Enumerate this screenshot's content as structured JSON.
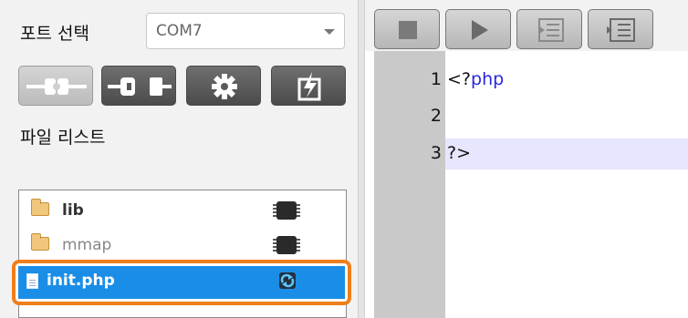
{
  "port": {
    "label": "포트 선택",
    "selected": "COM7"
  },
  "toolbar": {
    "buttons": [
      {
        "name": "connect",
        "icon": "plug-connect-icon",
        "enabled": false
      },
      {
        "name": "disconnect",
        "icon": "plug-disconnect-icon",
        "enabled": true
      },
      {
        "name": "settings",
        "icon": "gear-icon",
        "enabled": true
      },
      {
        "name": "flash",
        "icon": "flash-chip-icon",
        "enabled": true
      }
    ]
  },
  "files": {
    "label": "파일 리스트",
    "items": [
      {
        "name": "lib",
        "type": "folder",
        "icon": "chip-icon"
      },
      {
        "name": "mmap",
        "type": "folder",
        "icon": "chip-icon"
      },
      {
        "name": "init.php",
        "type": "file",
        "icon": "sync-icon",
        "selected": true
      }
    ]
  },
  "editor": {
    "toolbar": [
      {
        "name": "stop",
        "icon": "stop-icon"
      },
      {
        "name": "run",
        "icon": "play-icon"
      },
      {
        "name": "step-in",
        "icon": "step-in-icon"
      },
      {
        "name": "step-out",
        "icon": "step-out-icon"
      }
    ],
    "lines": [
      {
        "number": "1",
        "prefix": "<?",
        "keyword": "php"
      },
      {
        "number": "2",
        "prefix": "",
        "keyword": ""
      },
      {
        "number": "3",
        "prefix": "?>",
        "keyword": ""
      }
    ],
    "active_line": 3
  },
  "colors": {
    "selection": "#1a8ee6",
    "highlight_border": "#ee7f1b",
    "keyword": "#2727e0",
    "active_line": "#e6e6ff"
  }
}
